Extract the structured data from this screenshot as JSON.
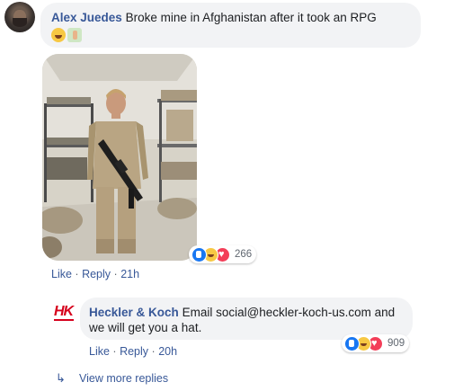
{
  "comment": {
    "author": "Alex Juedes",
    "text": "Broke mine in Afghanistan after it took an RPG",
    "emojis": [
      "laughing-emoji",
      "thumbs-up-emoji"
    ],
    "reactions": {
      "count": "266",
      "icons": [
        "like",
        "haha",
        "love"
      ]
    },
    "actions": {
      "like": "Like",
      "reply": "Reply",
      "time": "21h",
      "sep": "·"
    }
  },
  "reply": {
    "author": "Heckler & Koch",
    "text": "Email social@heckler-koch-us.com and we will get you a hat.",
    "logo_text": "HK",
    "reactions": {
      "count": "909",
      "icons": [
        "like",
        "haha",
        "love"
      ]
    },
    "actions": {
      "like": "Like",
      "reply": "Reply",
      "time": "20h",
      "sep": "·"
    }
  },
  "more_replies": {
    "label": "View more replies",
    "icon": "reply-arrow-icon"
  },
  "colors": {
    "link": "#385898",
    "bubble": "#f2f3f5",
    "meta": "#606770",
    "like_blue": "#1877f2",
    "love_red": "#f33e58",
    "hk_red": "#d6001c"
  }
}
